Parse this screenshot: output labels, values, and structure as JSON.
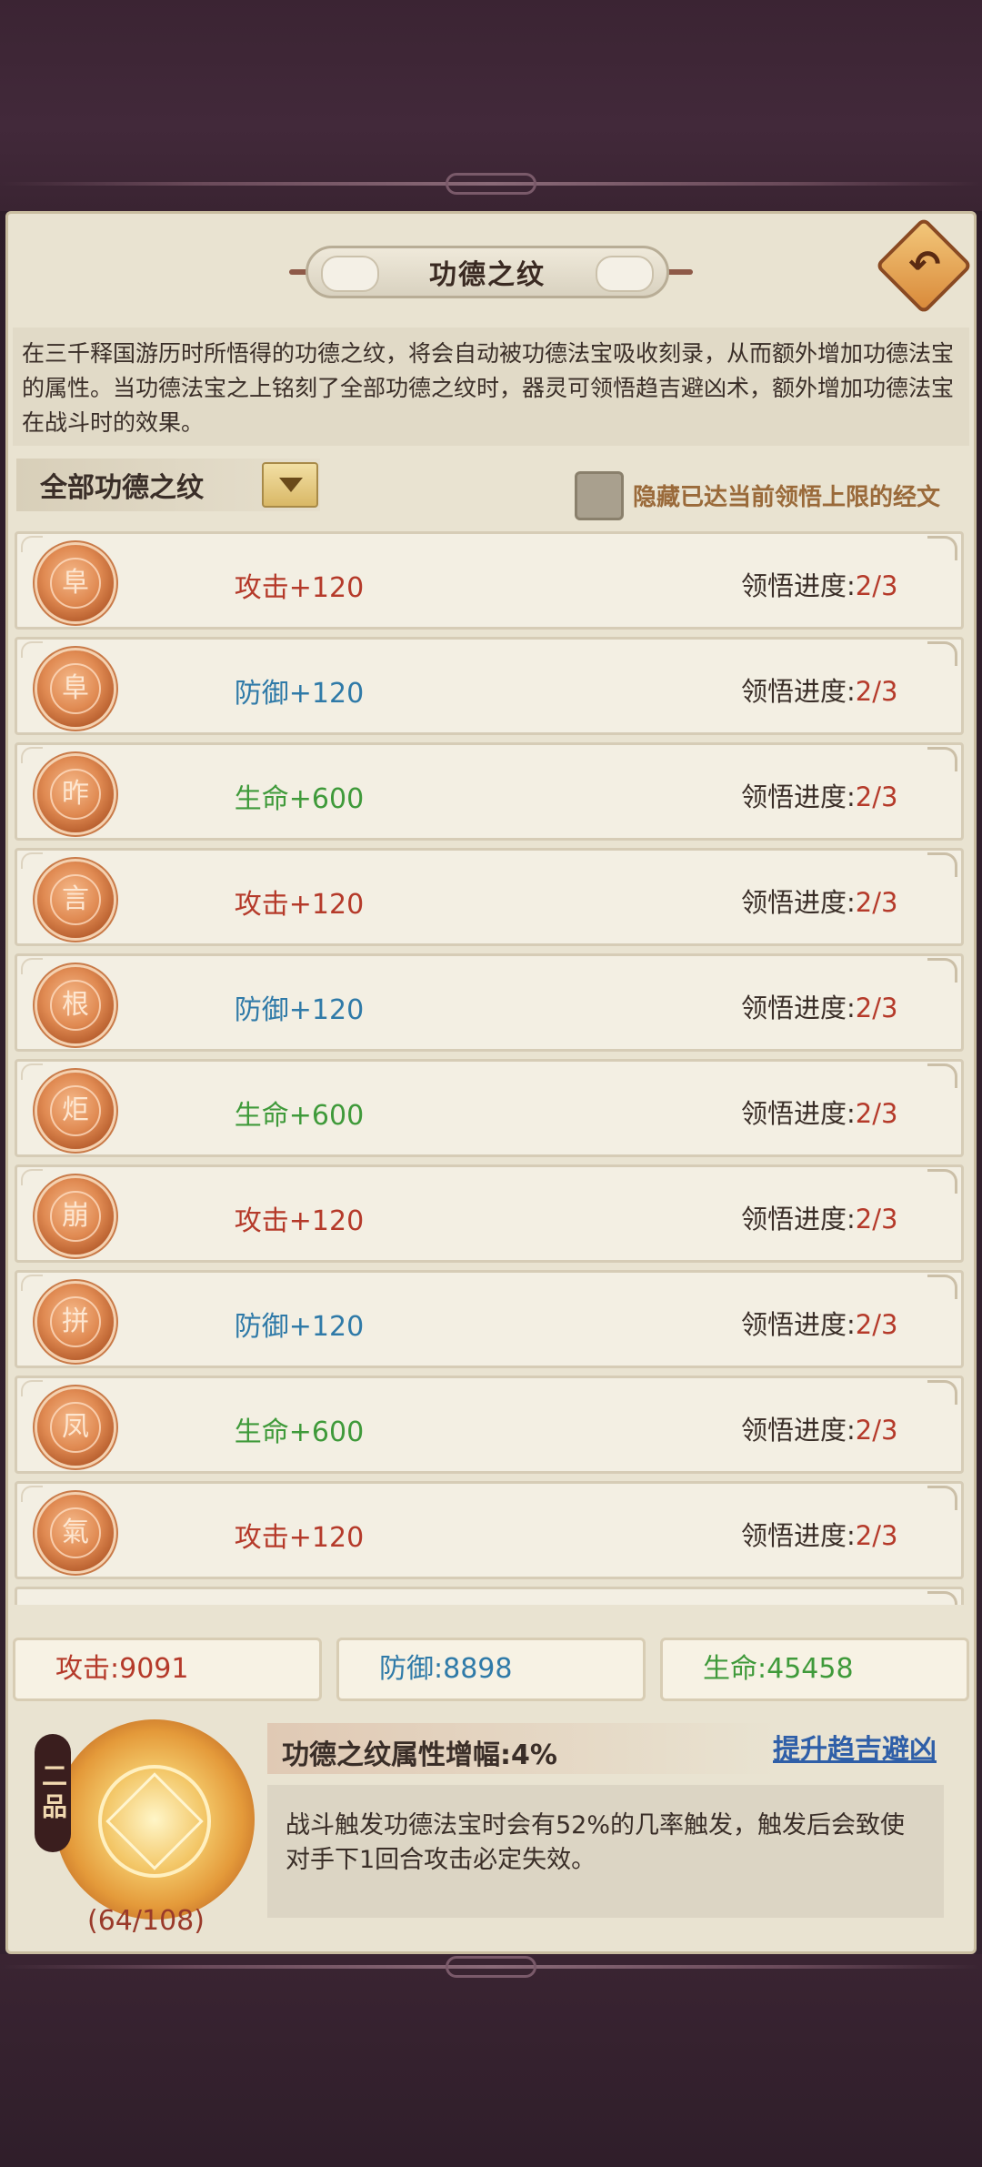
{
  "header": {
    "title": "功德之纹",
    "back_icon": "back-arrow-icon"
  },
  "description": "在三千释国游历时所悟得的功德之纹，将会自动被功德法宝吸收刻录，从而额外增加功德法宝的属性。当功德法宝之上铭刻了全部功德之纹时，器灵可领悟趋吉避凶术，额外增加功德法宝在战斗时的效果。",
  "filter": {
    "label": "全部功德之纹",
    "hide_label": "隐藏已达当前领悟上限的经文",
    "hide_checked": false
  },
  "rows": [
    {
      "glyph": "阜",
      "stat": "攻击+120",
      "type": "atk",
      "prog_label": "领悟进度:",
      "prog": "2/3"
    },
    {
      "glyph": "阜",
      "stat": "防御+120",
      "type": "def",
      "prog_label": "领悟进度:",
      "prog": "2/3"
    },
    {
      "glyph": "昨",
      "stat": "生命+600",
      "type": "hp",
      "prog_label": "领悟进度:",
      "prog": "2/3"
    },
    {
      "glyph": "言",
      "stat": "攻击+120",
      "type": "atk",
      "prog_label": "领悟进度:",
      "prog": "2/3"
    },
    {
      "glyph": "根",
      "stat": "防御+120",
      "type": "def",
      "prog_label": "领悟进度:",
      "prog": "2/3"
    },
    {
      "glyph": "炬",
      "stat": "生命+600",
      "type": "hp",
      "prog_label": "领悟进度:",
      "prog": "2/3"
    },
    {
      "glyph": "崩",
      "stat": "攻击+120",
      "type": "atk",
      "prog_label": "领悟进度:",
      "prog": "2/3"
    },
    {
      "glyph": "拼",
      "stat": "防御+120",
      "type": "def",
      "prog_label": "领悟进度:",
      "prog": "2/3"
    },
    {
      "glyph": "凤",
      "stat": "生命+600",
      "type": "hp",
      "prog_label": "领悟进度:",
      "prog": "2/3"
    },
    {
      "glyph": "氣",
      "stat": "攻击+120",
      "type": "atk",
      "prog_label": "领悟进度:",
      "prog": "2/3"
    }
  ],
  "totals": {
    "atk_label": "攻击:",
    "atk_value": "9091",
    "def_label": "防御:",
    "def_value": "8898",
    "hp_label": "生命:",
    "hp_value": "45458"
  },
  "bonus": {
    "grade": "二品",
    "count": "(64/108)",
    "title": "功德之纹属性增幅:4%",
    "link": "提升趋吉避凶",
    "desc": "战斗触发功德法宝时会有52%的几率触发，触发后会致使对手下1回合攻击必定失效。"
  },
  "colors": {
    "atk": "#b53a2a",
    "def": "#2f7aa8",
    "hp": "#3f9a3a",
    "panel": "#e9e3d1"
  }
}
